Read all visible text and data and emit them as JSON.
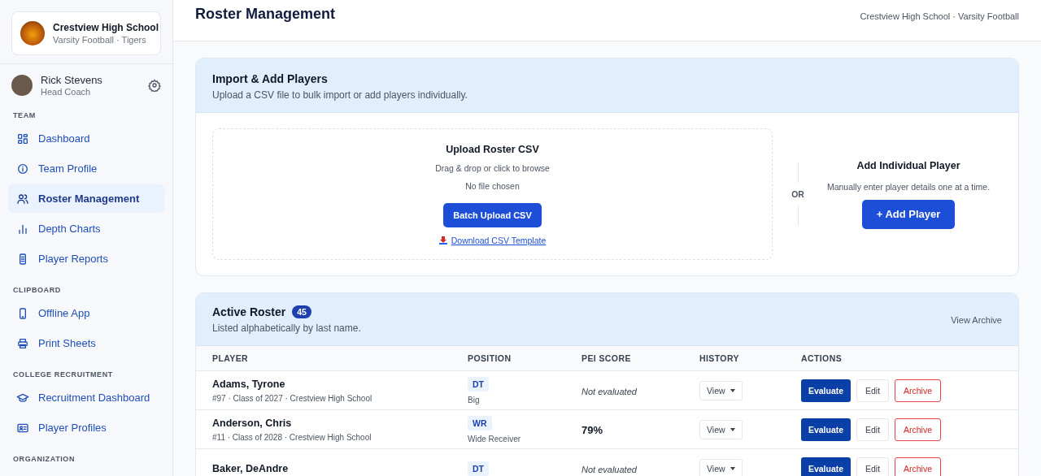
{
  "team_card": {
    "school": "Crestview High School",
    "subtitle": "Varsity Football · Tigers"
  },
  "user": {
    "name": "Rick Stevens",
    "role": "Head Coach"
  },
  "sidebar": {
    "sections": [
      {
        "title": "TEAM",
        "items": [
          {
            "label": "Dashboard",
            "kind": "grid",
            "selected": false
          },
          {
            "label": "Team Profile",
            "kind": "info",
            "selected": false
          },
          {
            "label": "Roster Management",
            "kind": "users",
            "selected": true
          },
          {
            "label": "Depth Charts",
            "kind": "bars",
            "selected": false
          },
          {
            "label": "Player Reports",
            "kind": "report",
            "selected": false
          }
        ]
      },
      {
        "title": "CLIPBOARD",
        "items": [
          {
            "label": "Offline App",
            "kind": "phone",
            "selected": false
          },
          {
            "label": "Print Sheets",
            "kind": "printer",
            "selected": false
          }
        ]
      },
      {
        "title": "COLLEGE RECRUITMENT",
        "items": [
          {
            "label": "Recruitment Dashboard",
            "kind": "cap",
            "selected": false
          },
          {
            "label": "Player Profiles",
            "kind": "idcard",
            "selected": false
          }
        ]
      },
      {
        "title": "ORGANIZATION"
      }
    ]
  },
  "header": {
    "title": "Roster Management",
    "breadcrumb": "Crestview High School · Varsity Football"
  },
  "import_card": {
    "title": "Import & Add Players",
    "subtitle": "Upload a CSV file to bulk import or add players individually.",
    "upload": {
      "title": "Upload Roster CSV",
      "hint": "Drag & drop or click to browse",
      "file_status": "No file chosen",
      "button": "Batch Upload CSV",
      "link": "Download CSV Template"
    },
    "divider": "OR",
    "add": {
      "title": "Add Individual Player",
      "hint": "Manually enter player details one at a time.",
      "button": "+ Add Player"
    }
  },
  "roster": {
    "title": "Active Roster",
    "count": "45",
    "subtitle": "Listed alphabetically by last name.",
    "archive_link": "View Archive",
    "columns": [
      "PLAYER",
      "POSITION",
      "PEI SCORE",
      "HISTORY",
      "ACTIONS"
    ],
    "rows": [
      {
        "name": "Adams, Tyrone",
        "meta": "#97 · Class of 2027 · Crestview High School",
        "position": "DT",
        "position_name": "Big",
        "score": "Not evaluated",
        "evaluated": false,
        "history": "View",
        "actions": [
          "Evaluate",
          "Edit",
          "Archive"
        ]
      },
      {
        "name": "Anderson, Chris",
        "meta": "#11 · Class of 2028 · Crestview High School",
        "position": "WR",
        "position_name": "Wide Receiver",
        "score": "79%",
        "evaluated": true,
        "history": "View",
        "actions": [
          "Evaluate",
          "Edit",
          "Archive"
        ]
      },
      {
        "name": "Baker, DeAndre",
        "position": "DT",
        "score": "Not evaluated",
        "evaluated": false,
        "history": "View",
        "actions": [
          "Evaluate",
          "Edit",
          "Archive"
        ]
      }
    ]
  }
}
